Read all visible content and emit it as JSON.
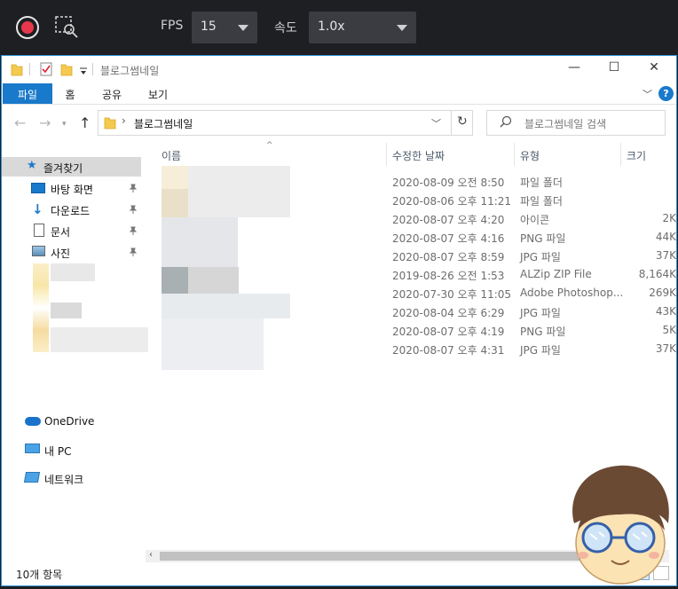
{
  "recorder": {
    "fps_label": "FPS",
    "fps_value": "15",
    "speed_label": "속도",
    "speed_value": "1.0x"
  },
  "window": {
    "title": "블로그썸네일",
    "minimize": "—",
    "maximize": "☐",
    "close": "✕"
  },
  "ribbon": {
    "tabs": [
      "파일",
      "홈",
      "공유",
      "보기"
    ],
    "help": "?"
  },
  "address": {
    "path": "블로그썸네일",
    "search_placeholder": "블로그썸네일 검색"
  },
  "nav": {
    "quick_access": "즐겨찾기",
    "pinned": [
      "바탕 화면",
      "다운로드",
      "문서",
      "사진"
    ],
    "onedrive": "OneDrive",
    "this_pc": "내 PC",
    "network": "네트워크"
  },
  "columns": {
    "name": "이름",
    "date": "수정한 날짜",
    "type": "유형",
    "size": "크기"
  },
  "files": [
    {
      "date": "2020-08-09 오전 8:50",
      "type": "파일 폴더",
      "size": ""
    },
    {
      "date": "2020-08-06 오후 11:21",
      "type": "파일 폴더",
      "size": ""
    },
    {
      "date": "2020-08-07 오후 4:20",
      "type": "아이콘",
      "size": "2K"
    },
    {
      "date": "2020-08-07 오후 4:16",
      "type": "PNG 파일",
      "size": "44K"
    },
    {
      "date": "2020-08-07 오후 8:59",
      "type": "JPG 파일",
      "size": "37K"
    },
    {
      "date": "2019-08-26 오전 1:53",
      "type": "ALZip ZIP File",
      "size": "8,164K"
    },
    {
      "date": "2020-07-30 오후 11:05",
      "type": "Adobe Photoshop...",
      "size": "269K"
    },
    {
      "date": "2020-08-04 오후 6:29",
      "type": "JPG 파일",
      "size": "43K"
    },
    {
      "date": "2020-08-07 오후 4:19",
      "type": "PNG 파일",
      "size": "5K"
    },
    {
      "date": "2020-08-07 오후 4:31",
      "type": "JPG 파일",
      "size": "37K"
    }
  ],
  "status": {
    "item_count": "10개 항목"
  },
  "colors": {
    "accent": "#1979ca",
    "record": "#e8374a",
    "folder": "#f4c94f"
  }
}
